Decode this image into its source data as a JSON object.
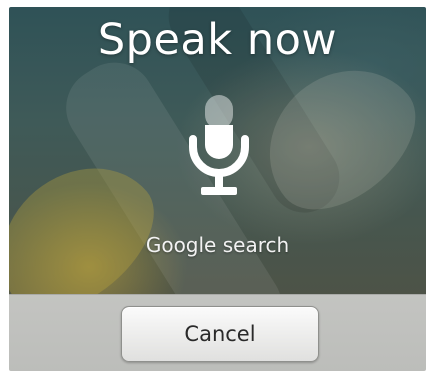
{
  "dialog": {
    "title": "Speak now",
    "subtitle": "Google search",
    "icon": "microphone-icon"
  },
  "buttons": {
    "cancel_label": "Cancel"
  },
  "colors": {
    "title_text": "#ffffff",
    "background_top": "#2f5257",
    "background_bottom": "#4d5347",
    "button_bar": "#c3c4c1"
  }
}
